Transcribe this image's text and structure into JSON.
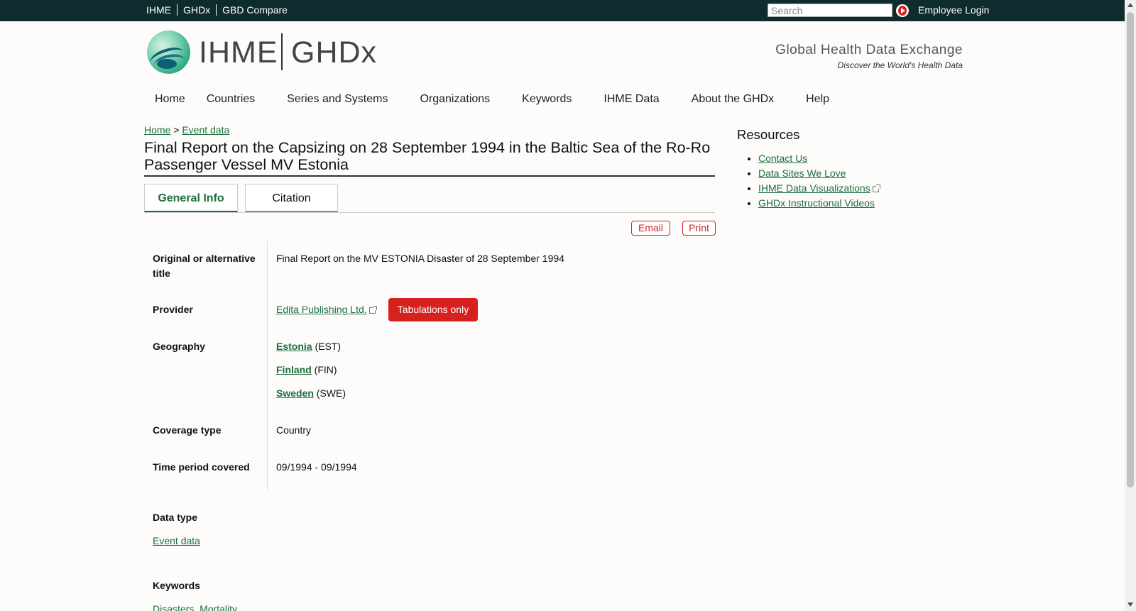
{
  "topbar": {
    "links": [
      "IHME",
      "GHDx",
      "GBD Compare"
    ],
    "search_placeholder": "Search",
    "employee_login": "Employee Login"
  },
  "header": {
    "logo_ihme": "IHME",
    "logo_ghdx": "GHDx",
    "tagline": "Global Health Data Exchange",
    "subtagline": "Discover the World's Health Data"
  },
  "nav": [
    "Home",
    "Countries",
    "Series and Systems",
    "Organizations",
    "Keywords",
    "IHME Data",
    "About the GHDx",
    "Help"
  ],
  "breadcrumb": {
    "home": "Home",
    "sep": ">",
    "current": "Event data"
  },
  "title": "Final Report on the Capsizing on 28 September 1994 in the Baltic Sea of the Ro-Ro Passenger Vessel MV Estonia",
  "tabs": {
    "general": "General Info",
    "citation": "Citation"
  },
  "actions": {
    "email": "Email",
    "print": "Print"
  },
  "fields": {
    "alt_title_label": "Original or alternative title",
    "alt_title_value": "Final Report on the MV ESTONIA Disaster of 28 September 1994",
    "provider_label": "Provider",
    "provider_value": "Edita Publishing Ltd.",
    "provider_badge": "Tabulations only",
    "geography_label": "Geography",
    "geo": [
      {
        "name": "Estonia",
        "code": "(EST)"
      },
      {
        "name": "Finland",
        "code": "(FIN)"
      },
      {
        "name": "Sweden",
        "code": "(SWE)"
      }
    ],
    "coverage_label": "Coverage type",
    "coverage_value": "Country",
    "time_label": "Time period covered",
    "time_value": "09/1994 - 09/1994",
    "datatype_label": "Data type",
    "datatype_value": "Event data",
    "keywords_label": "Keywords",
    "keywords_value": "Disasters, Mortality"
  },
  "resources": {
    "title": "Resources",
    "items": [
      "Contact Us",
      "Data Sites We Love",
      "IHME Data Visualizations",
      "GHDx Instructional Videos"
    ]
  },
  "colors": {
    "topbar": "#0e2b2e",
    "link": "#1c6e3d",
    "accent_red": "#d8201f"
  }
}
